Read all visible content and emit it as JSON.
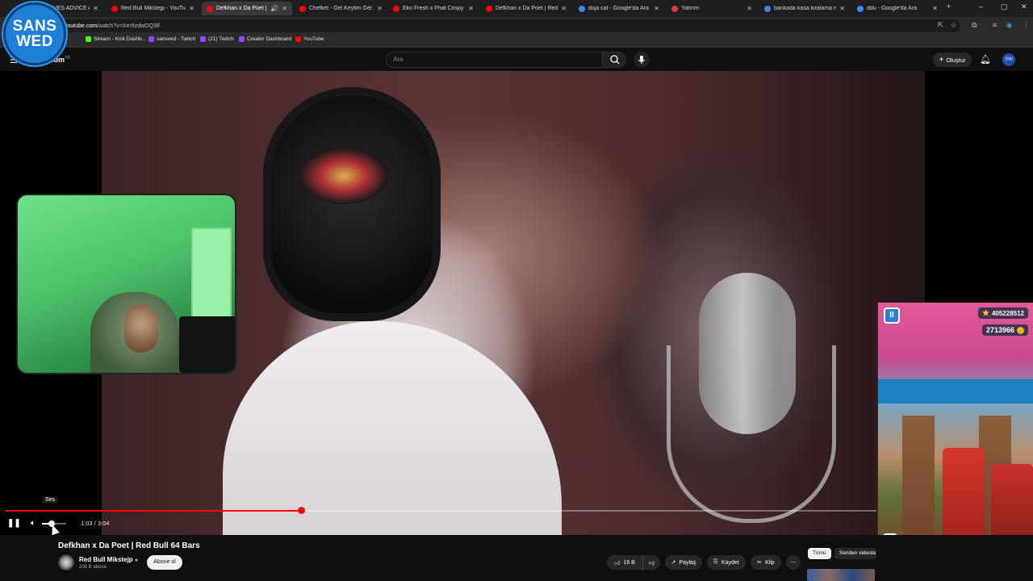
{
  "browser": {
    "tabs": [
      {
        "title": "VES ADVICE AS A",
        "color": "#ff0000",
        "active": false
      },
      {
        "title": "Red Bull Mikstejp - YouTube",
        "color": "#ff0000",
        "active": false
      },
      {
        "title": "Defkhan x Da Poet | Red B",
        "color": "#ff0000",
        "active": true
      },
      {
        "title": "Chefket - Gel Keyfim Gel [Offi",
        "color": "#ff0000",
        "active": false
      },
      {
        "title": "Eko Fresh x Phat Crispy & Kor",
        "color": "#ff0000",
        "active": false
      },
      {
        "title": "Defkhan x Da Poet | Red Bull",
        "color": "#ff0000",
        "active": false
      },
      {
        "title": "doja cat - Google'da Ara",
        "color": "#4285f4",
        "active": false
      },
      {
        "title": "Yatırım",
        "color": "#e03a3a",
        "active": false
      },
      {
        "title": "bankada kasa kiralama ne ka",
        "color": "#4285f4",
        "active": false
      },
      {
        "title": "ddu - Google'da Ara",
        "color": "#4285f4",
        "active": false
      }
    ],
    "url_host": "youtube.com",
    "url_path": "/watch?v=Xer9zdwOQ3E",
    "bookmarks": [
      {
        "label": "Stream - Kick Dashb...",
        "color": "#53fc18"
      },
      {
        "label": "sansved - Twitch",
        "color": "#9146ff"
      },
      {
        "label": "(21) Twitch",
        "color": "#9146ff"
      },
      {
        "label": "Creator Dashboard",
        "color": "#9146ff"
      },
      {
        "label": "YouTube",
        "color": "#ff0000"
      }
    ]
  },
  "youtube": {
    "logo_text": "mium",
    "logo_sup": "TR",
    "search_placeholder": "Ara",
    "create_label": "Oluştur",
    "avatar_initials": "SW"
  },
  "player": {
    "tooltip": "Ses",
    "time": "1:03 / 3:04",
    "progress": 0.34,
    "volume": 0.4
  },
  "video": {
    "title": "Defkhan x Da Poet | Red Bull 64 Bars",
    "channel": "Red Bull Mikstejp",
    "subscribers": "208 B abone",
    "subscribe_label": "Abone ol",
    "likes": "15 B",
    "share_label": "Paylaş",
    "save_label": "Kaydet",
    "clip_label": "Klip"
  },
  "chips": [
    "Tümü",
    "Seriden videola"
  ],
  "game": {
    "top_score": "405228512",
    "coins": "2713966"
  },
  "badge": {
    "line1": "SANS",
    "line2": "WED"
  }
}
